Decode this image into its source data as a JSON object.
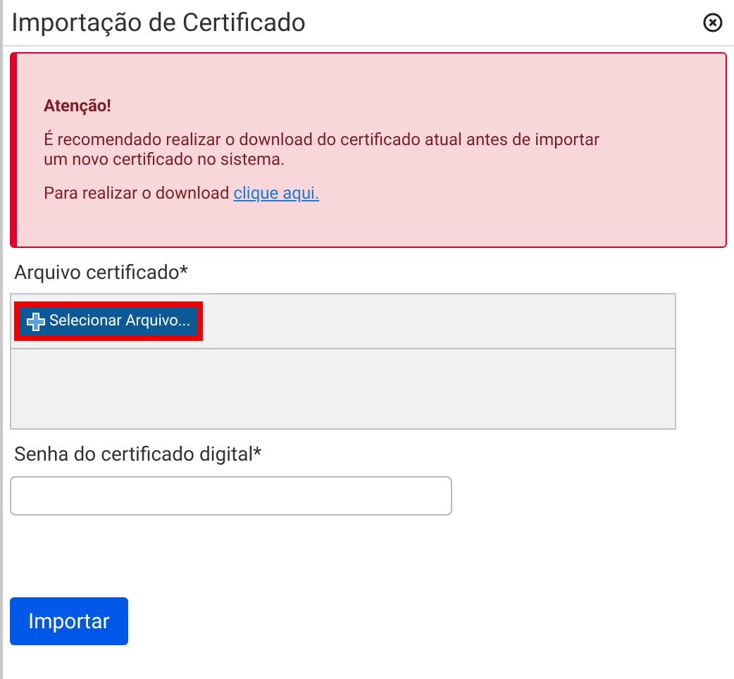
{
  "dialog": {
    "title": "Importação de Certificado"
  },
  "alert": {
    "heading": "Atenção!",
    "message": "É recomendado realizar o download do certificado atual antes de importar um novo certificado no sistema.",
    "download_text": "Para realizar o download",
    "download_link": "clique aqui."
  },
  "file_field": {
    "label": "Arquivo certificado*",
    "button": "Selecionar Arquivo..."
  },
  "password_field": {
    "label": "Senha do certificado digital*"
  },
  "buttons": [
    "Importar"
  ]
}
